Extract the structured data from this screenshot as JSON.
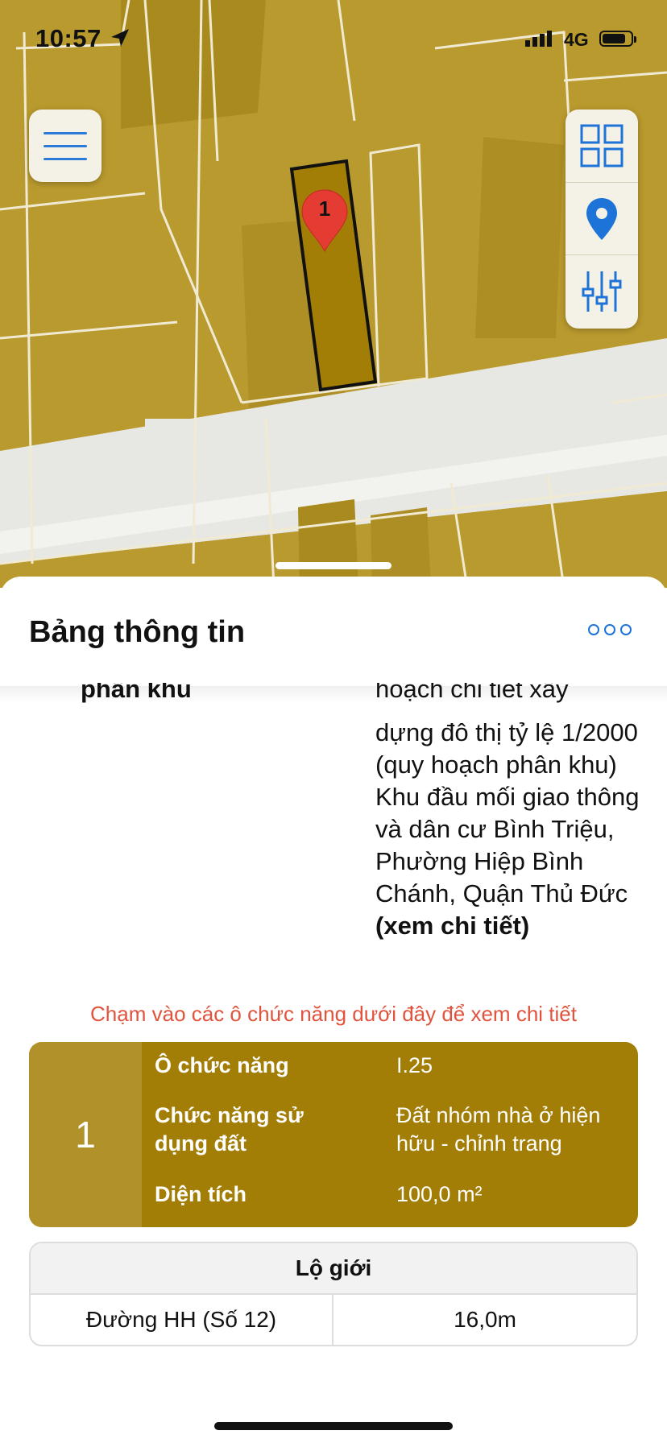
{
  "status_bar": {
    "time": "10:57",
    "network": "4G",
    "icons": [
      "location-arrow-icon",
      "signal-icon",
      "battery-icon"
    ]
  },
  "map": {
    "pin_label": "1",
    "buttons": [
      "menu-icon",
      "grid-icon",
      "location-pin-icon",
      "sliders-icon"
    ],
    "colors": {
      "land": "#b99a2e",
      "parcel": "#a37e06",
      "road": "#e7e7e4",
      "pin": "#e43b33",
      "accent": "#1e73d8"
    }
  },
  "sheet": {
    "title": "Bảng thông tin",
    "more_icon": "ellipsis-icon",
    "cut_left_text": "phân khu",
    "cut_right_text": "hoạch chi tiết xây",
    "description": "dựng đô thị tỷ lệ 1/2000 (quy hoạch phân khu) Khu đầu mối giao thông và dân cư Bình Triệu, Phường Hiệp Bình Chánh, Quận Thủ Đức",
    "detail_link": "(xem chi tiết)",
    "hint": "Chạm vào các ô chức năng dưới đây để xem chi tiết",
    "lot": {
      "index": "1",
      "rows": [
        {
          "key": "Ô chức năng",
          "value": "I.25"
        },
        {
          "key": "Chức năng sử dụng đất",
          "value": "Đất nhóm nhà ở hiện hữu - chỉnh trang"
        },
        {
          "key": "Diện tích",
          "value": "100,0 m²"
        }
      ]
    },
    "road_width": {
      "header": "Lộ giới",
      "road": "Đường HH (Số 12)",
      "width": "16,0m"
    }
  }
}
